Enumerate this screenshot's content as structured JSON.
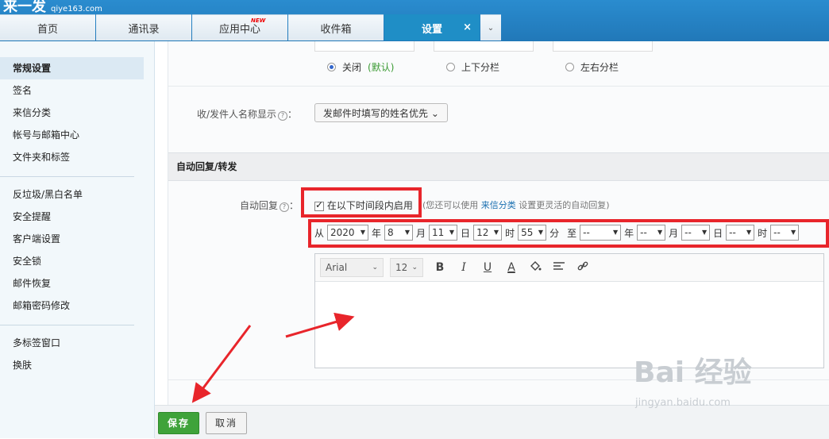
{
  "app": {
    "logo": "来一发",
    "domain": "qiye163.com"
  },
  "tabs": [
    {
      "label": "首页"
    },
    {
      "label": "通讯录"
    },
    {
      "label": "应用中心",
      "badge": "NEW"
    },
    {
      "label": "收件箱"
    },
    {
      "label": "设置",
      "active": true,
      "close": "×"
    }
  ],
  "tab_more_icon": "chevron-down-icon",
  "sidebar": {
    "group1": [
      "常规设置",
      "签名",
      "来信分类",
      "帐号与邮箱中心",
      "文件夹和标签"
    ],
    "group2": [
      "反垃圾/黑白名单",
      "安全提醒",
      "客户端设置",
      "安全锁",
      "邮件恢复",
      "邮箱密码修改"
    ],
    "group3": [
      "多标签窗口",
      "换肤"
    ]
  },
  "layout": {
    "options": [
      {
        "label": "关闭",
        "default_note": "(默认)",
        "checked": true
      },
      {
        "label": "上下分栏",
        "checked": false
      },
      {
        "label": "左右分栏",
        "checked": false
      }
    ]
  },
  "sender_name": {
    "label": "收/发件人名称显示",
    "help": "?",
    "colon": "：",
    "value": "发邮件时填写的姓名优先",
    "arrow": "⌄"
  },
  "auto_reply": {
    "section_title": "自动回复/转发",
    "label": "自动回复",
    "help": "?",
    "colon": "：",
    "checkbox_label": "在以下时间段内启用",
    "checked": true,
    "hint_pre": "(您还可以使用",
    "hint_link": "来信分类",
    "hint_post": "设置更灵活的自动回复)",
    "from_label": "从",
    "to_label": "至",
    "start": {
      "year": "2020",
      "year_unit": "年",
      "month": "8",
      "month_unit": "月",
      "day": "11",
      "day_unit": "日",
      "hour": "12",
      "hour_unit": "时",
      "minute": "55",
      "minute_unit": "分"
    },
    "end": {
      "year": "--",
      "year_unit": "年",
      "month": "--",
      "month_unit": "月",
      "day": "--",
      "day_unit": "日",
      "hour": "--",
      "hour_unit": "时",
      "minute": "--"
    }
  },
  "editor": {
    "font": "Arial",
    "size": "12",
    "bold": "B",
    "italic": "I",
    "underline": "U",
    "font_color": "A",
    "body": ""
  },
  "footer": {
    "save": "保存",
    "cancel": "取消"
  },
  "watermark": {
    "text": "Bai 经验",
    "sub": "jingyan.baidu.com"
  },
  "colors": {
    "accent": "#1f8ec6",
    "highlight": "#e8252b",
    "save": "#3fa33a"
  }
}
